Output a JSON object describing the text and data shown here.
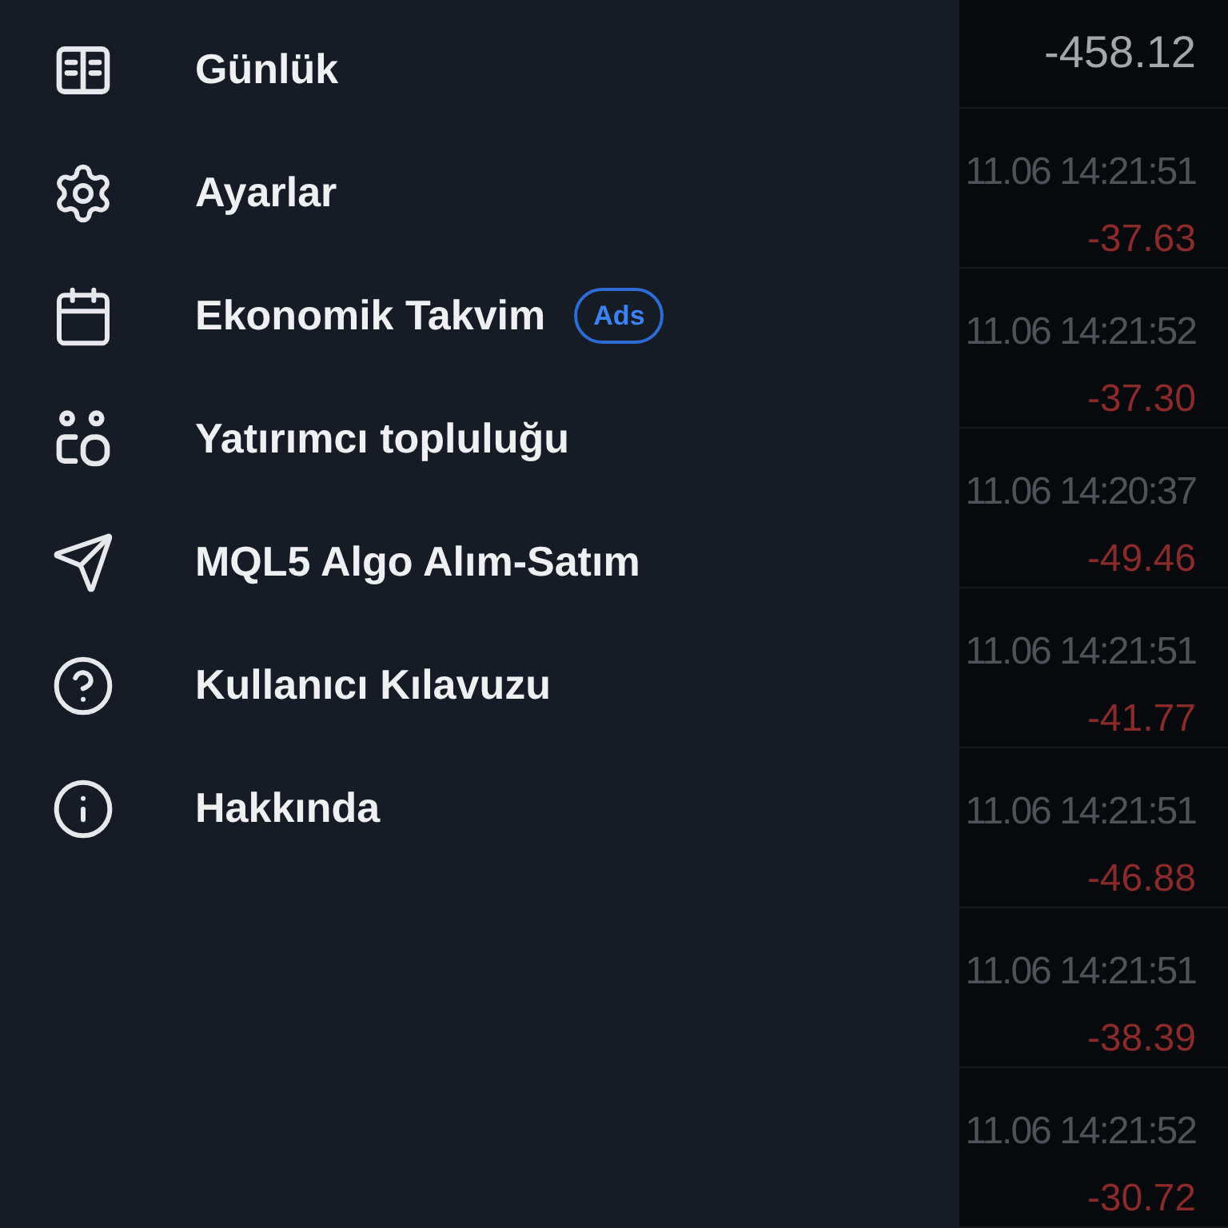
{
  "drawer": {
    "items": [
      {
        "label": "Günlük"
      },
      {
        "label": "Ayarlar"
      },
      {
        "label": "Ekonomik Takvim",
        "badge": "Ads"
      },
      {
        "label": "Yatırımcı topluluğu"
      },
      {
        "label": "MQL5 Algo Alım-Satım"
      },
      {
        "label": "Kullanıcı Kılavuzu"
      },
      {
        "label": "Hakkında"
      }
    ]
  },
  "history": {
    "total": "-458.12",
    "rows": [
      {
        "time": "11.06 14:21:51",
        "profit": "-37.63"
      },
      {
        "time": "11.06 14:21:52",
        "profit": "-37.30"
      },
      {
        "time": "11.06 14:20:37",
        "profit": "-49.46"
      },
      {
        "time": "11.06 14:21:51",
        "profit": "-41.77"
      },
      {
        "time": "11.06 14:21:51",
        "profit": "-46.88"
      },
      {
        "time": "11.06 14:21:51",
        "profit": "-38.39"
      },
      {
        "time": "11.06 14:21:52",
        "profit": "-30.72"
      }
    ]
  }
}
